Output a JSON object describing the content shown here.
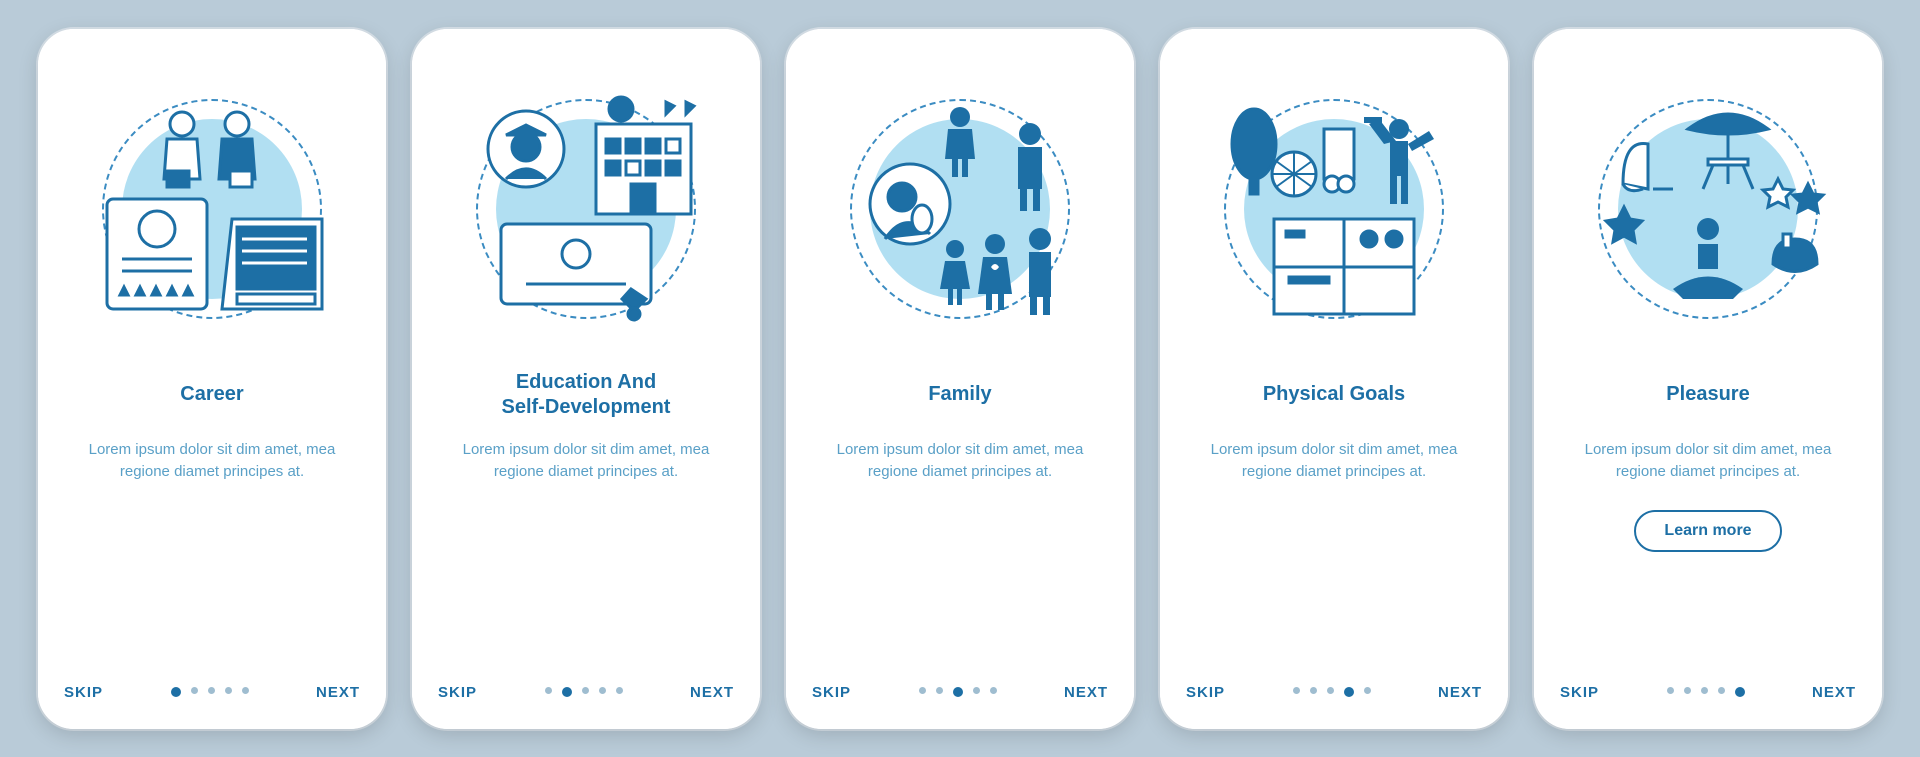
{
  "common": {
    "skip_label": "SKIP",
    "next_label": "NEXT",
    "learn_more_label": "Learn more",
    "description": "Lorem ipsum dolor sit dim amet, mea regione diamet principes at.",
    "total_dots": 5
  },
  "screens": [
    {
      "title": "Career",
      "icon": "career-illustration",
      "active_index": 0,
      "has_learn_more": false
    },
    {
      "title": "Education And\nSelf-Development",
      "icon": "education-illustration",
      "active_index": 1,
      "has_learn_more": false
    },
    {
      "title": "Family",
      "icon": "family-illustration",
      "active_index": 2,
      "has_learn_more": false
    },
    {
      "title": "Physical Goals",
      "icon": "fitness-illustration",
      "active_index": 3,
      "has_learn_more": false
    },
    {
      "title": "Pleasure",
      "icon": "pleasure-illustration",
      "active_index": 4,
      "has_learn_more": true
    }
  ],
  "colors": {
    "background": "#b9cbd8",
    "primary": "#1d6fa5",
    "accent_light": "#b1dff2",
    "text_muted": "#5aa0c7"
  }
}
